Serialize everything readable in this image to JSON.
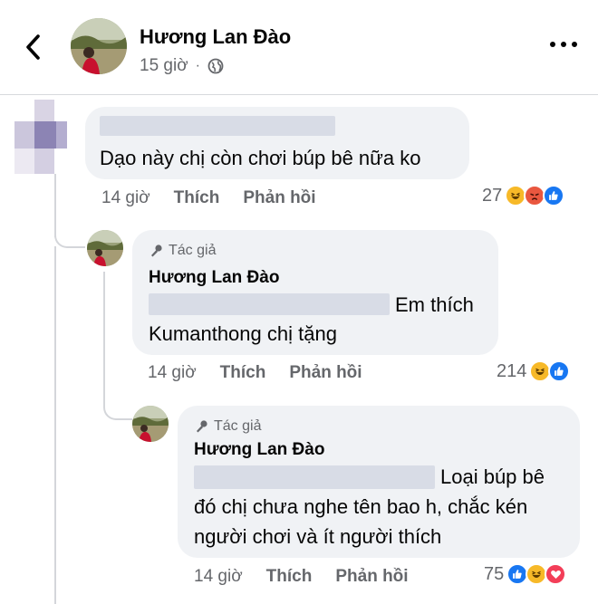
{
  "header": {
    "name": "Hương Lan Đào",
    "time": "15 giờ",
    "separator": "·",
    "icons": {
      "back": "back-chevron-icon",
      "privacy": "globe-icon",
      "menu": "more-options-icon"
    }
  },
  "comment1": {
    "text": "Dạo này chị còn chơi búp bê nữa ko",
    "time": "14 giờ",
    "like": "Thích",
    "reply": "Phản hồi",
    "reaction_count": "27",
    "reactions": [
      "haha",
      "angry",
      "like"
    ]
  },
  "reply1": {
    "badge": "Tác giả",
    "name": "Hương Lan Đào",
    "text_line1": "Em thích",
    "text_line2": "Kumanthong chị tặng",
    "time": "14 giờ",
    "like": "Thích",
    "reply": "Phản hồi",
    "reaction_count": "214",
    "reactions": [
      "haha",
      "like"
    ]
  },
  "reply2": {
    "badge": "Tác giả",
    "name": "Hương Lan Đào",
    "text_line1": "Loại búp bê",
    "text_line2": "đó chị chưa nghe tên bao h, chắc kén",
    "text_line3": "người chơi và ít người thích",
    "time": "14 giờ",
    "like": "Thích",
    "reply": "Phản hồi",
    "reaction_count": "75",
    "reactions": [
      "like",
      "haha",
      "love"
    ]
  },
  "colors": {
    "like": "#1877f2",
    "haha": "#f7b928",
    "angry": "#e9573f",
    "love": "#f33e58",
    "bubble": "#f0f2f5",
    "muted": "#65676b"
  }
}
